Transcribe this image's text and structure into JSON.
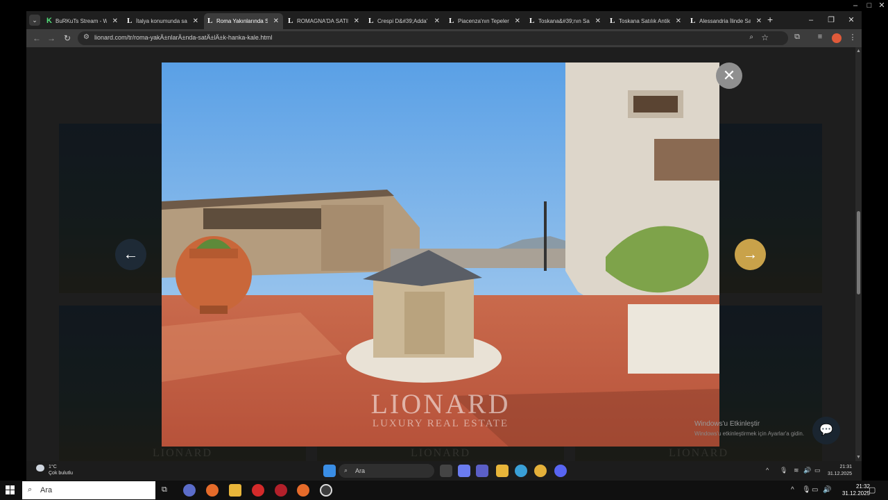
{
  "browser": {
    "tabs": [
      {
        "favicon": "K",
        "label": "BuRKuTs Stream - W",
        "active": false
      },
      {
        "favicon": "L",
        "label": "İtalya konumunda sa",
        "active": false
      },
      {
        "favicon": "L",
        "label": "Roma Yakınlarında Sa",
        "active": true
      },
      {
        "favicon": "L",
        "label": "ROMAGNA'DA SATIL",
        "active": false
      },
      {
        "favicon": "L",
        "label": "Crespi D&#39;Adda'",
        "active": false
      },
      {
        "favicon": "L",
        "label": "Piacenza'nın Tepelen",
        "active": false
      },
      {
        "favicon": "L",
        "label": "Toskana&#39;nın Sa",
        "active": false
      },
      {
        "favicon": "L",
        "label": "Toskana Satılık Antik",
        "active": false
      },
      {
        "favicon": "L",
        "label": "Alessandria İlinde Sa",
        "active": false
      }
    ],
    "url": "lionard.com/tr/roma-yakÄ±nlarÄ±nda-satÄ±lÄ±k-hanka-kale.html"
  },
  "lightbox": {
    "watermark_brand": "LIONARD",
    "watermark_tagline": "LUXURY REAL ESTATE"
  },
  "page_bg": {
    "card_watermark": "LIONARD"
  },
  "windows_activation": {
    "title": "Windows'u Etkinleştir",
    "subtitle": "Windows'u etkinleştirmek için Ayarlar'a gidin."
  },
  "inner_taskbar": {
    "weather_temp": "1°C",
    "weather_desc": "Çok bulutlu",
    "search_placeholder": "Ara",
    "time": "21:31",
    "date": "31.12.2025"
  },
  "outer_taskbar": {
    "search_placeholder": "Ara",
    "time": "21:32",
    "date": "31.12.2025"
  },
  "colors": {
    "next_button": "#c9a24a",
    "prev_button": "#1e2a36",
    "close_button": "#8f8f8f"
  }
}
